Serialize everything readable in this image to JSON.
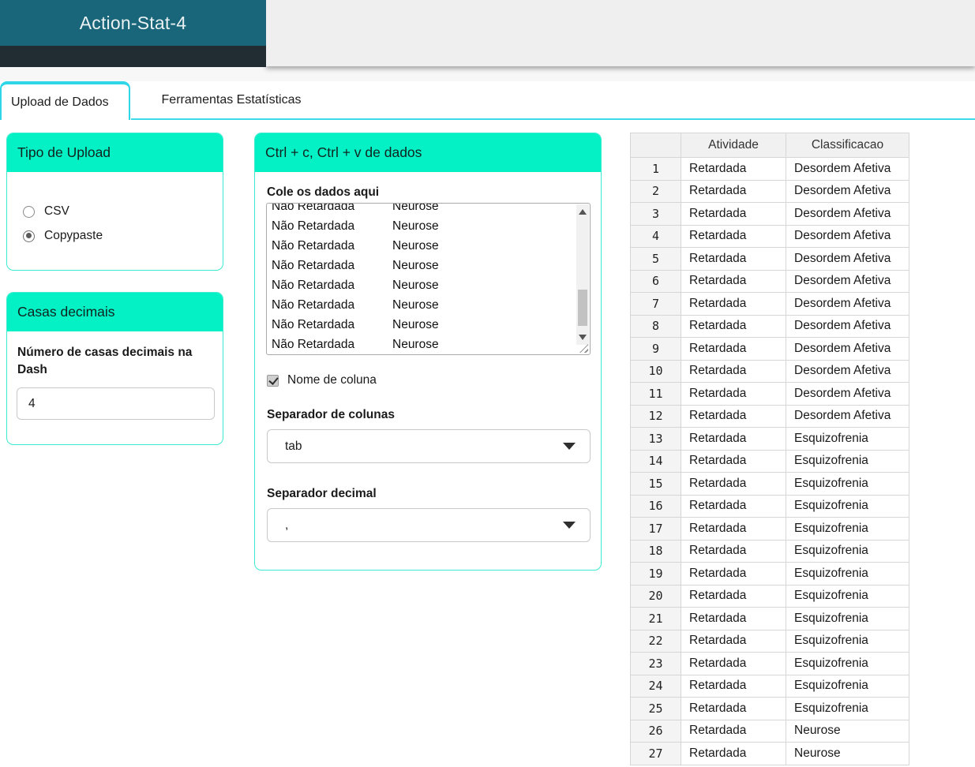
{
  "app": {
    "title": "Action-Stat-4"
  },
  "tabs": {
    "upload_label": "Upload de Dados",
    "tools_label": "Ferramentas Estatísticas"
  },
  "upload_type": {
    "title": "Tipo de Upload",
    "options": [
      {
        "label": "CSV",
        "selected": false
      },
      {
        "label": "Copypaste",
        "selected": true
      }
    ]
  },
  "decimals": {
    "title": "Casas decimais",
    "label": "Número de casas decimais na Dash",
    "value": "4"
  },
  "paste": {
    "title": "Ctrl + c, Ctrl + v de dados",
    "label": "Cole os dados aqui",
    "lines": [
      {
        "activity": "Não Retardada",
        "classification": "Neurose"
      },
      {
        "activity": "Não Retardada",
        "classification": "Neurose"
      },
      {
        "activity": "Não Retardada",
        "classification": "Neurose"
      },
      {
        "activity": "Não Retardada",
        "classification": "Neurose"
      },
      {
        "activity": "Não Retardada",
        "classification": "Neurose"
      },
      {
        "activity": "Não Retardada",
        "classification": "Neurose"
      },
      {
        "activity": "Não Retardada",
        "classification": "Neurose"
      },
      {
        "activity": "Não Retardada",
        "classification": "Neurose"
      }
    ],
    "checkbox_label": "Nome de coluna",
    "checkbox_checked": true,
    "column_separator_label": "Separador de colunas",
    "column_separator_value": "tab",
    "decimal_separator_label": "Separador decimal",
    "decimal_separator_value": ","
  },
  "table": {
    "headers": [
      "",
      "Atividade",
      "Classificacao"
    ],
    "rows": [
      [
        "1",
        "Retardada",
        "Desordem Afetiva"
      ],
      [
        "2",
        "Retardada",
        "Desordem Afetiva"
      ],
      [
        "3",
        "Retardada",
        "Desordem Afetiva"
      ],
      [
        "4",
        "Retardada",
        "Desordem Afetiva"
      ],
      [
        "5",
        "Retardada",
        "Desordem Afetiva"
      ],
      [
        "6",
        "Retardada",
        "Desordem Afetiva"
      ],
      [
        "7",
        "Retardada",
        "Desordem Afetiva"
      ],
      [
        "8",
        "Retardada",
        "Desordem Afetiva"
      ],
      [
        "9",
        "Retardada",
        "Desordem Afetiva"
      ],
      [
        "10",
        "Retardada",
        "Desordem Afetiva"
      ],
      [
        "11",
        "Retardada",
        "Desordem Afetiva"
      ],
      [
        "12",
        "Retardada",
        "Desordem Afetiva"
      ],
      [
        "13",
        "Retardada",
        "Esquizofrenia"
      ],
      [
        "14",
        "Retardada",
        "Esquizofrenia"
      ],
      [
        "15",
        "Retardada",
        "Esquizofrenia"
      ],
      [
        "16",
        "Retardada",
        "Esquizofrenia"
      ],
      [
        "17",
        "Retardada",
        "Esquizofrenia"
      ],
      [
        "18",
        "Retardada",
        "Esquizofrenia"
      ],
      [
        "19",
        "Retardada",
        "Esquizofrenia"
      ],
      [
        "20",
        "Retardada",
        "Esquizofrenia"
      ],
      [
        "21",
        "Retardada",
        "Esquizofrenia"
      ],
      [
        "22",
        "Retardada",
        "Esquizofrenia"
      ],
      [
        "23",
        "Retardada",
        "Esquizofrenia"
      ],
      [
        "24",
        "Retardada",
        "Esquizofrenia"
      ],
      [
        "25",
        "Retardada",
        "Esquizofrenia"
      ],
      [
        "26",
        "Retardada",
        "Neurose"
      ],
      [
        "27",
        "Retardada",
        "Neurose"
      ]
    ]
  },
  "colors": {
    "header_teal": "#196579",
    "header_dark": "#222d33",
    "panel_accent": "#04f1c6",
    "card_border": "#3cead0",
    "tab_accent": "#2ed6e7",
    "table_border": "#d6d6d6"
  }
}
